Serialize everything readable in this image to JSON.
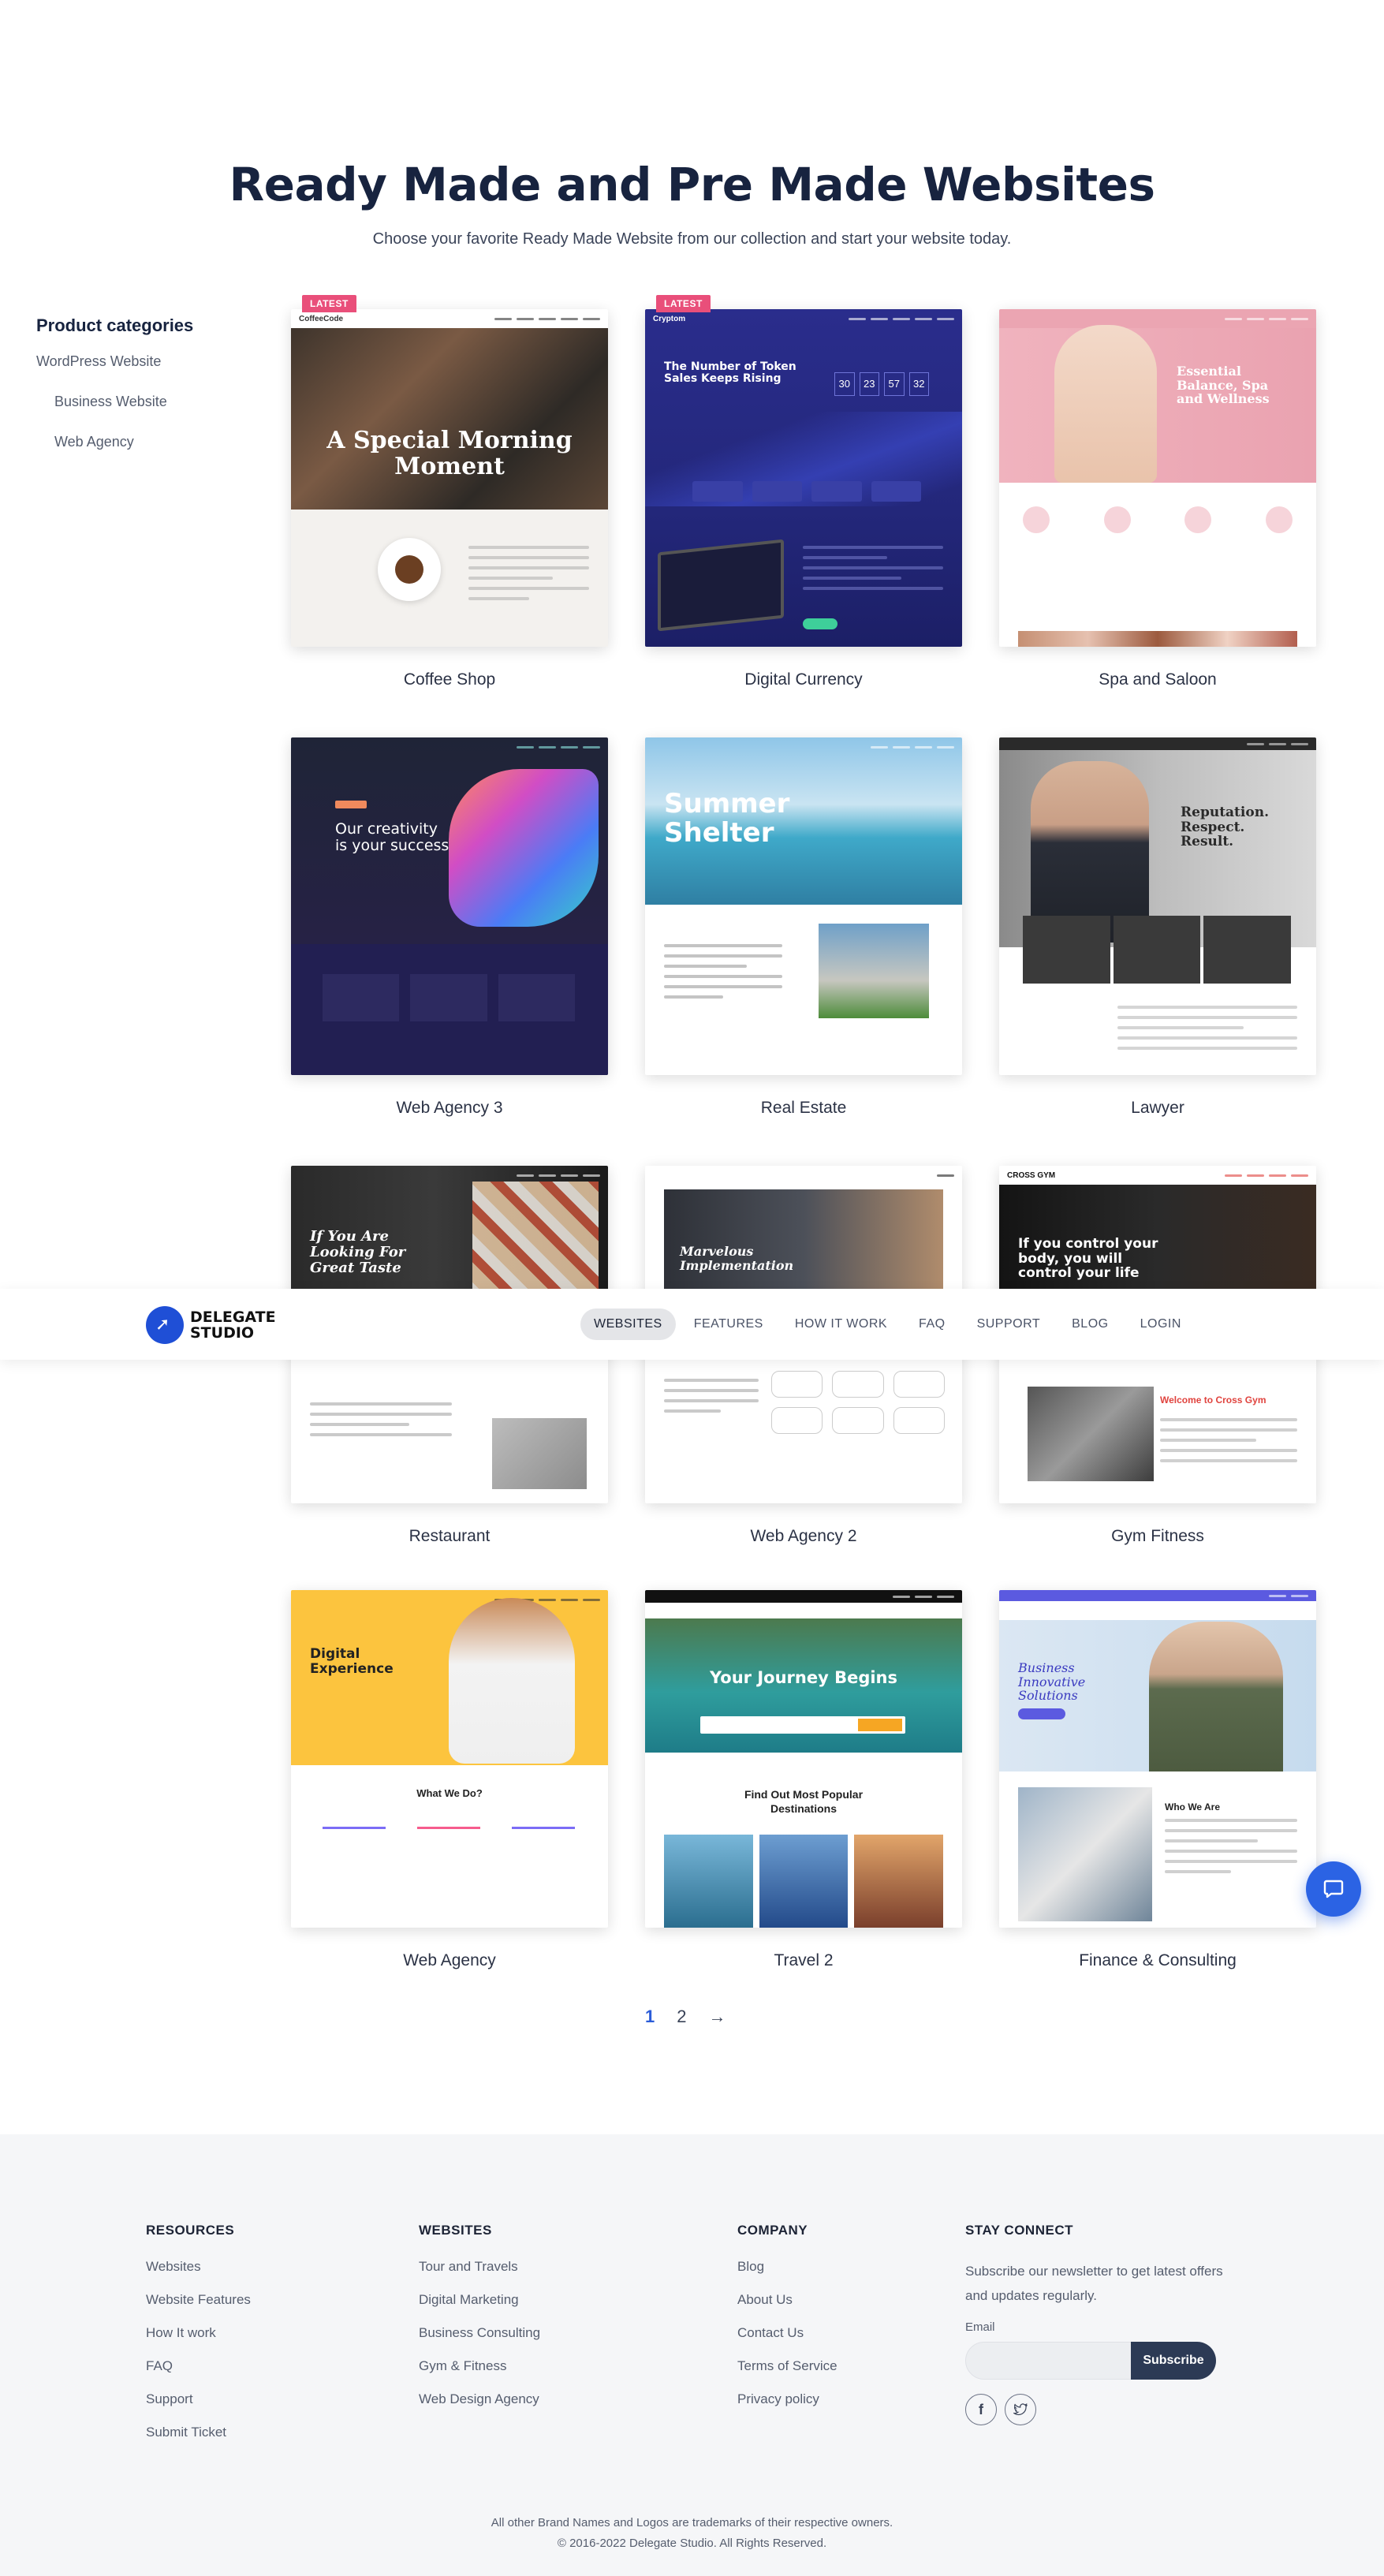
{
  "hero": {
    "title": "Ready Made and Pre Made Websites",
    "subtitle": "Choose your favorite Ready Made Website from our collection and start your website today."
  },
  "sidebar": {
    "heading": "Product categories",
    "items": [
      {
        "label": "WordPress Website"
      },
      {
        "label": "Business Website"
      },
      {
        "label": "Web Agency"
      }
    ]
  },
  "templates": [
    {
      "title": "Coffee Shop",
      "badge": "LATEST",
      "brand": "CoffeeCode",
      "headline": "A Special Morning Moment"
    },
    {
      "title": "Digital Currency",
      "badge": "LATEST",
      "brand": "Cryptom",
      "headline": "The Number of Token Sales Keeps Rising"
    },
    {
      "title": "Spa and Saloon",
      "headline": "Essential Balance, Spa and Wellness"
    },
    {
      "title": "Web Agency 3",
      "headline": "Our creativity is your success"
    },
    {
      "title": "Real Estate",
      "headline": "Summer Shelter"
    },
    {
      "title": "Lawyer",
      "headline": "Reputation. Respect. Result."
    },
    {
      "title": "Restaurant",
      "headline": "If You Are Looking For Great Taste"
    },
    {
      "title": "Web Agency 2",
      "headline": "Marvelous Implementation"
    },
    {
      "title": "Gym Fitness",
      "brand": "CROSS GYM",
      "headline": "If you control your body, you will control your life"
    },
    {
      "title": "Web Agency",
      "headline": "Digital Experience"
    },
    {
      "title": "Travel 2",
      "headline": "Your Journey Begins"
    },
    {
      "title": "Finance & Consulting",
      "headline": "Business Innovative Solutions"
    }
  ],
  "nav": {
    "logo_line1": "DELEGATE",
    "logo_line2": "STUDIO",
    "items": [
      {
        "label": "WEBSITES"
      },
      {
        "label": "FEATURES"
      },
      {
        "label": "HOW IT WORK"
      },
      {
        "label": "FAQ"
      },
      {
        "label": "SUPPORT"
      },
      {
        "label": "BLOG"
      },
      {
        "label": "LOGIN"
      }
    ]
  },
  "pagination": {
    "pages": [
      "1",
      "2"
    ],
    "next": "→",
    "current": "1"
  },
  "footer": {
    "resources": {
      "heading": "RESOURCES",
      "links": [
        "Websites",
        "Website Features",
        "How It work",
        "FAQ",
        "Support",
        "Submit Ticket"
      ]
    },
    "websites": {
      "heading": "WEBSITES",
      "links": [
        "Tour and Travels",
        "Digital Marketing",
        "Business Consulting",
        "Gym & Fitness",
        "Web Design Agency"
      ]
    },
    "company": {
      "heading": "COMPANY",
      "links": [
        "Blog",
        "About Us",
        "Contact Us",
        "Terms of Service",
        "Privacy policy"
      ]
    },
    "connect": {
      "heading": "STAY CONNECT",
      "text": "Subscribe our newsletter to get latest offers and updates regularly.",
      "email_label": "Email",
      "email_placeholder": "",
      "button": "Subscribe",
      "socials": [
        "facebook-icon",
        "twitter-icon"
      ]
    },
    "trademark": "All other Brand Names and Logos are trademarks of their respective owners.",
    "copyright": "© 2016-2022 Delegate Studio. All Rights Reserved."
  },
  "colors": {
    "accent": "#2b5cd8",
    "heading": "#17233f",
    "badge": "#e94f7a",
    "button": "#2c3a55"
  }
}
